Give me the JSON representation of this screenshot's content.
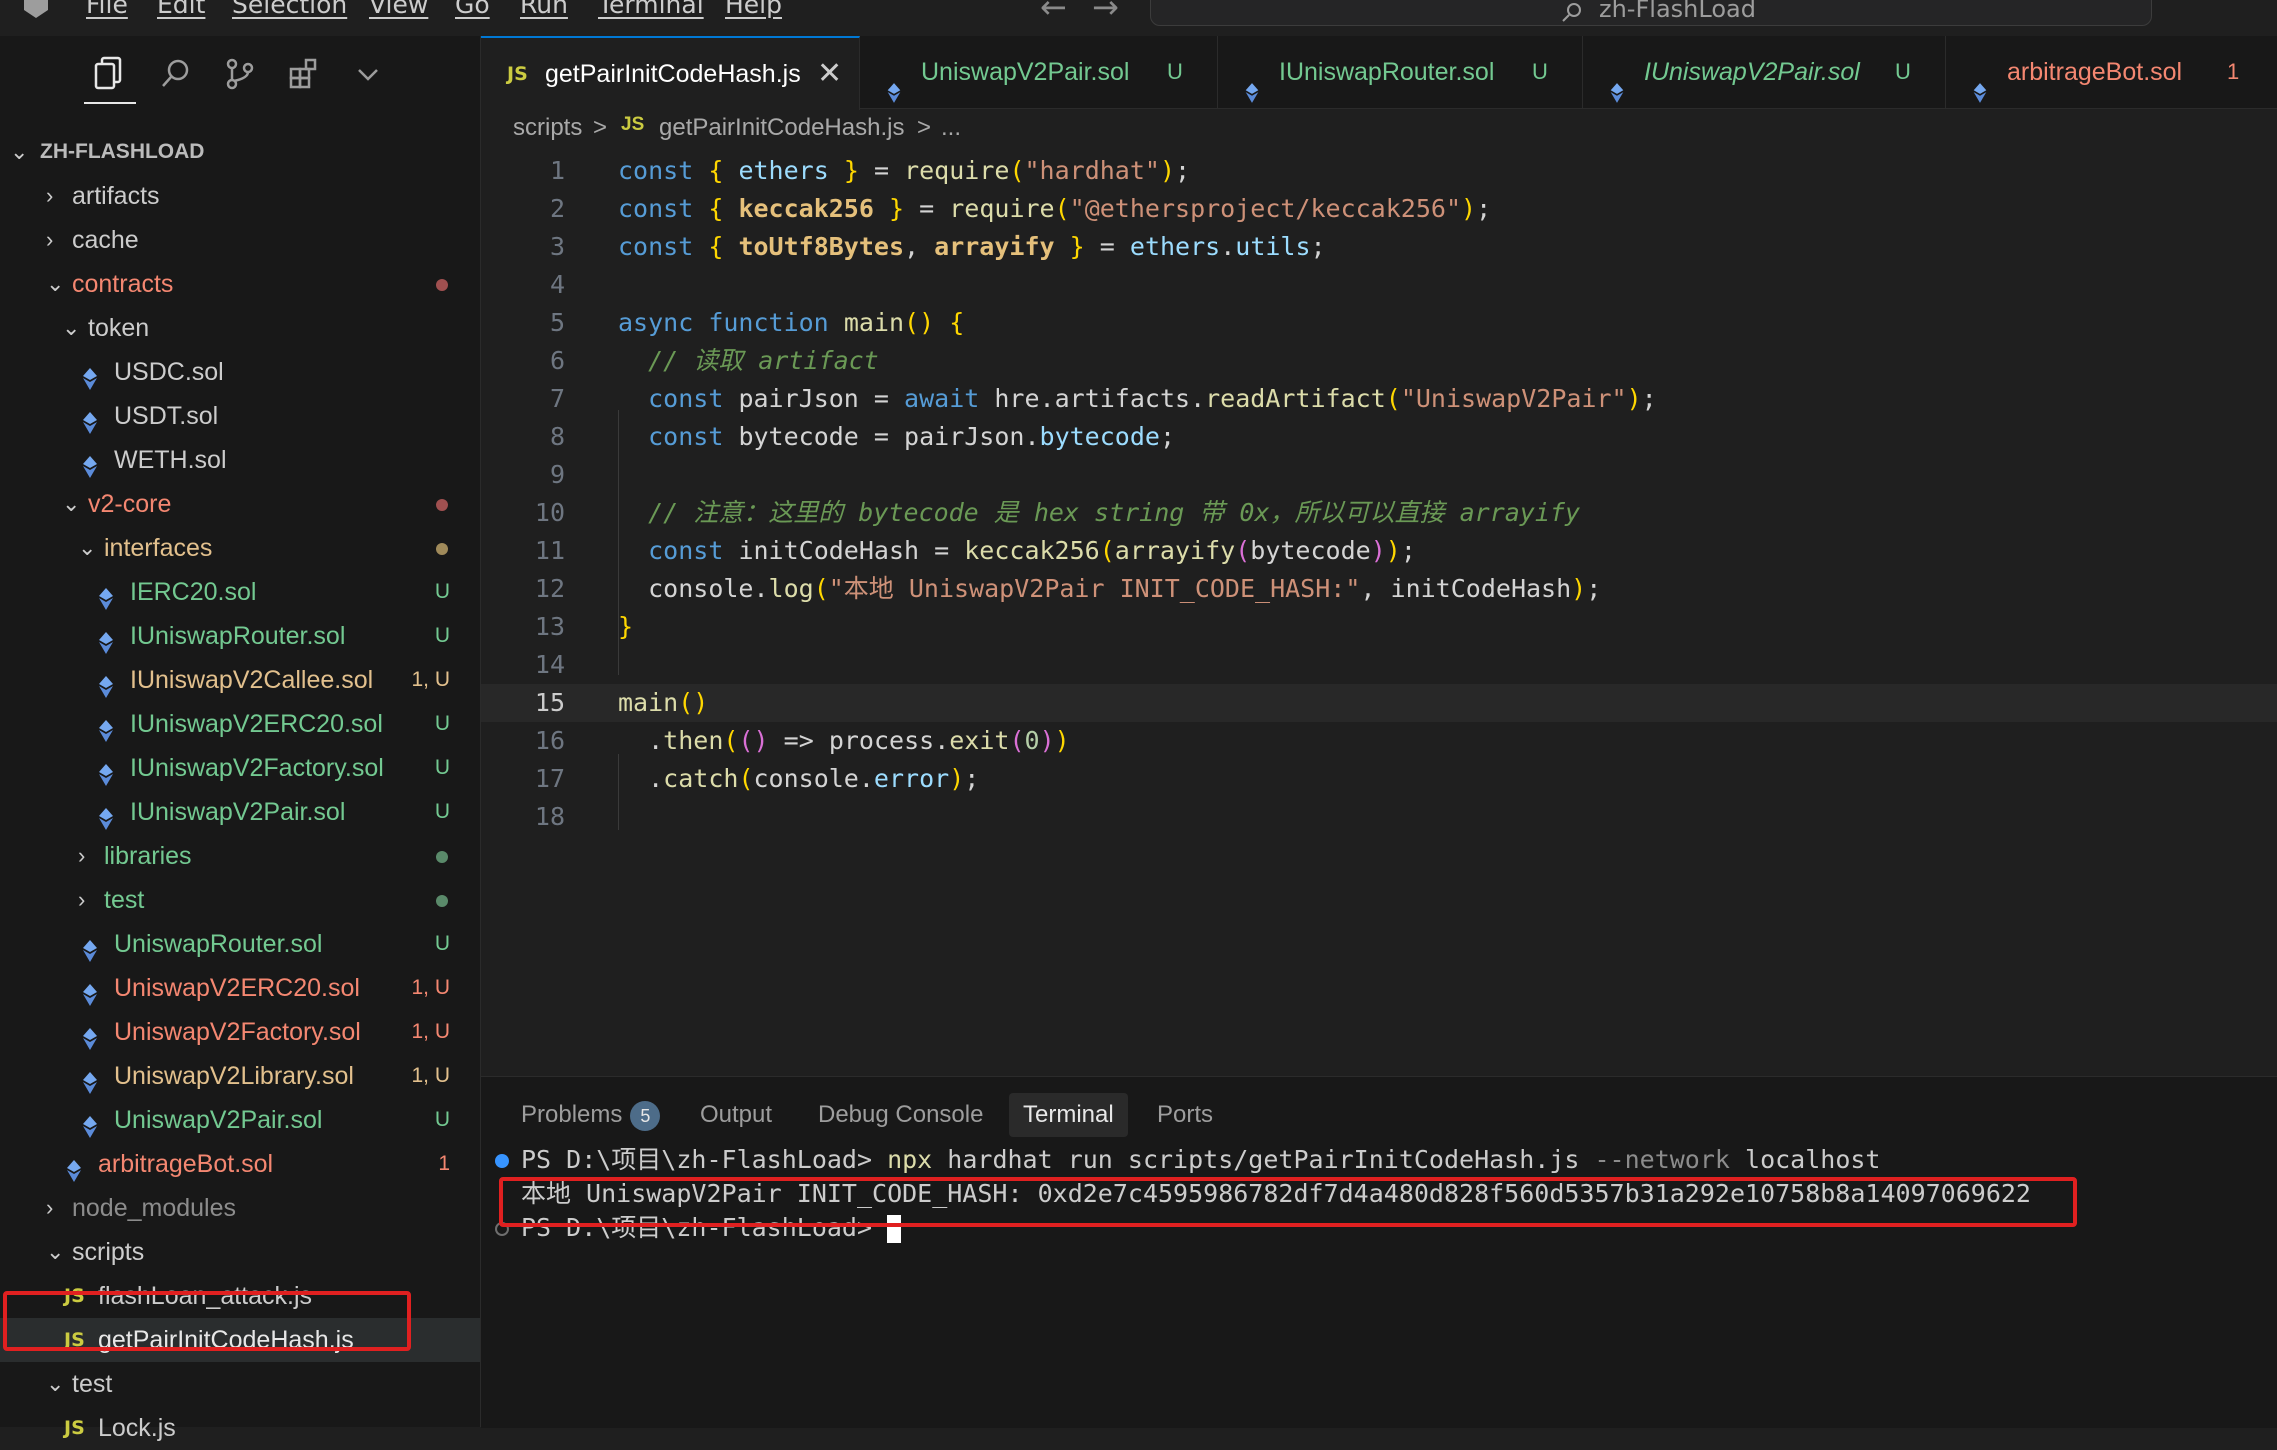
{
  "window": {
    "menu": [
      "File",
      "Edit",
      "Selection",
      "View",
      "Go",
      "Run",
      "Terminal",
      "Help"
    ],
    "search_text": "zh-FlashLoad"
  },
  "explorer": {
    "root": "ZH-FLASHLOAD",
    "items": [
      {
        "label": "artifacts",
        "type": "folder",
        "open": false,
        "color": "#cccccc"
      },
      {
        "label": "cache",
        "type": "folder",
        "open": false,
        "color": "#cccccc"
      },
      {
        "label": "contracts",
        "type": "folder",
        "open": true,
        "color": "#f48771",
        "dot": "#a05050"
      },
      {
        "label": "token",
        "type": "folder",
        "open": true,
        "color": "#cccccc"
      },
      {
        "label": "USDC.sol",
        "type": "sol",
        "color": "#cccccc"
      },
      {
        "label": "USDT.sol",
        "type": "sol",
        "color": "#cccccc"
      },
      {
        "label": "WETH.sol",
        "type": "sol",
        "color": "#cccccc"
      },
      {
        "label": "v2-core",
        "type": "folder",
        "open": true,
        "color": "#f48771",
        "dot": "#a05050"
      },
      {
        "label": "interfaces",
        "type": "folder",
        "open": true,
        "color": "#e2c08d",
        "dot": "#a08a5a"
      },
      {
        "label": "IERC20.sol",
        "type": "sol",
        "color": "#73c991",
        "badge": "U"
      },
      {
        "label": "IUniswapRouter.sol",
        "type": "sol",
        "color": "#73c991",
        "badge": "U"
      },
      {
        "label": "IUniswapV2Callee.sol",
        "type": "sol",
        "color": "#e2c08d",
        "badge": "1, U"
      },
      {
        "label": "IUniswapV2ERC20.sol",
        "type": "sol",
        "color": "#73c991",
        "badge": "U"
      },
      {
        "label": "IUniswapV2Factory.sol",
        "type": "sol",
        "color": "#73c991",
        "badge": "U"
      },
      {
        "label": "IUniswapV2Pair.sol",
        "type": "sol",
        "color": "#73c991",
        "badge": "U"
      },
      {
        "label": "libraries",
        "type": "folder",
        "open": false,
        "color": "#73c991",
        "dot": "#5a8a6a"
      },
      {
        "label": "test",
        "type": "folder",
        "open": false,
        "color": "#73c991",
        "dot": "#5a8a6a"
      },
      {
        "label": "UniswapRouter.sol",
        "type": "sol",
        "color": "#73c991",
        "badge": "U"
      },
      {
        "label": "UniswapV2ERC20.sol",
        "type": "sol",
        "color": "#f48771",
        "badge": "1, U"
      },
      {
        "label": "UniswapV2Factory.sol",
        "type": "sol",
        "color": "#f48771",
        "badge": "1, U"
      },
      {
        "label": "UniswapV2Library.sol",
        "type": "sol",
        "color": "#e2c08d",
        "badge": "1, U"
      },
      {
        "label": "UniswapV2Pair.sol",
        "type": "sol",
        "color": "#73c991",
        "badge": "U"
      },
      {
        "label": "arbitrageBot.sol",
        "type": "sol",
        "color": "#f48771",
        "badge": "1"
      },
      {
        "label": "node_modules",
        "type": "folder",
        "open": false,
        "color": "#8c8c8c"
      },
      {
        "label": "scripts",
        "type": "folder",
        "open": true,
        "color": "#cccccc"
      },
      {
        "label": "flashLoan_attack.js",
        "type": "js",
        "color": "#cccccc"
      },
      {
        "label": "getPairInitCodeHash.js",
        "type": "js",
        "color": "#e7e7e7",
        "selected": true
      },
      {
        "label": "test",
        "type": "folder",
        "open": true,
        "color": "#cccccc"
      },
      {
        "label": "Lock.js",
        "type": "js",
        "color": "#cccccc"
      }
    ]
  },
  "tabs": [
    {
      "label": "getPairInitCodeHash.js",
      "kind": "js",
      "active": true
    },
    {
      "label": "UniswapV2Pair.sol",
      "kind": "sol",
      "status": "U",
      "color": "#73c991"
    },
    {
      "label": "IUniswapRouter.sol",
      "kind": "sol",
      "status": "U",
      "color": "#73c991"
    },
    {
      "label": "IUniswapV2Pair.sol",
      "kind": "sol",
      "status": "U",
      "color": "#73c991",
      "italic": true
    },
    {
      "label": "arbitrageBot.sol",
      "kind": "sol",
      "status": "1",
      "color": "#f48771"
    }
  ],
  "breadcrumb": [
    "scripts",
    ">",
    "getPairInitCodeHash.js",
    ">",
    "..."
  ],
  "editor": {
    "current_line": 15,
    "lines": [
      "const { ethers } = require(\"hardhat\");",
      "const { keccak256 } = require(\"@ethersproject/keccak256\");",
      "const { toUtf8Bytes, arrayify } = ethers.utils;",
      "",
      "async function main() {",
      "  // 读取 artifact",
      "  const pairJson = await hre.artifacts.readArtifact(\"UniswapV2Pair\");",
      "  const bytecode = pairJson.bytecode;",
      "",
      "  // 注意：这里的 bytecode 是 hex string 带 0x，所以可以直接 arrayify",
      "  const initCodeHash = keccak256(arrayify(bytecode));",
      "  console.log(\"本地 UniswapV2Pair INIT_CODE_HASH:\", initCodeHash);",
      "}",
      "",
      "main()",
      "  .then(() => process.exit(0))",
      "  .catch(console.error);",
      ""
    ]
  },
  "panel": {
    "tabs": [
      "Problems",
      "Output",
      "Debug Console",
      "Terminal",
      "Ports"
    ],
    "active_tab": "Terminal",
    "problems_count": "5",
    "terminal": {
      "prompt1": "PS D:\\项目\\zh-FlashLoad> ",
      "cmd_npx": "npx",
      "cmd_rest": " hardhat run scripts/getPairInitCodeHash.js ",
      "cmd_flag": "--network",
      "cmd_arg": " localhost",
      "output": "本地 UniswapV2Pair INIT_CODE_HASH: 0xd2e7c4595986782df7d4a480d828f560d5357b31a292e10758b8a14097069622",
      "prompt2": "PS D:\\项目\\zh-FlashLoad> "
    }
  }
}
